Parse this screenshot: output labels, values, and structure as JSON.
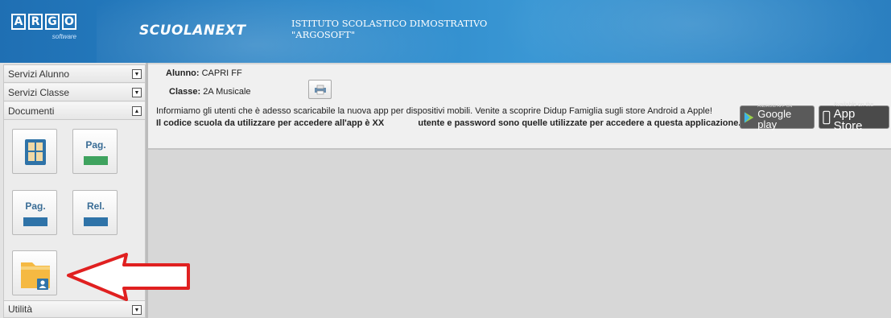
{
  "header": {
    "logo_letters": [
      "A",
      "R",
      "G",
      "O"
    ],
    "logo_sub": "software",
    "brand": "SCUOLANEXT",
    "school_line1": "ISTITUTO SCOLASTICO DIMOSTRATIVO",
    "school_line2": "\"ARGOSOFT\""
  },
  "sidebar": {
    "sections": [
      {
        "label": "Servizi Alunno",
        "state": "collapsed"
      },
      {
        "label": "Servizi Classe",
        "state": "collapsed"
      },
      {
        "label": "Documenti",
        "state": "expanded"
      },
      {
        "label": "Utilità",
        "state": "collapsed"
      }
    ],
    "documenti_icons": [
      {
        "name": "grid-document-icon",
        "label": ""
      },
      {
        "name": "pag-green-icon",
        "label": "Pag."
      },
      {
        "name": "pag-blue-icon",
        "label": "Pag."
      },
      {
        "name": "rel-blue-icon",
        "label": "Rel."
      },
      {
        "name": "folder-user-icon",
        "label": ""
      }
    ]
  },
  "student": {
    "alunno_label": "Alunno:",
    "alunno_value": "CAPRI FF",
    "classe_label": "Classe:",
    "classe_value": "2A Musicale"
  },
  "notice": {
    "line1": "Informiamo gli utenti che è adesso scaricabile la nuova app per dispositivi mobili. Venite a scoprire Didup Famiglia sugli store Android a Apple!",
    "line2_part1": "Il codice scuola da utilizzare per accedere all'app è XX",
    "line2_part2": "utente e password sono quelle utilizzate per accedere a questa applicazione."
  },
  "stores": {
    "google_small": "ANDROID APP ON",
    "google_big": "Google play",
    "apple_small": "Available on the",
    "apple_big": "App Store"
  },
  "colors": {
    "header_blue": "#2a86c8",
    "arrow_red": "#e02020",
    "folder_orange": "#f5b942"
  }
}
